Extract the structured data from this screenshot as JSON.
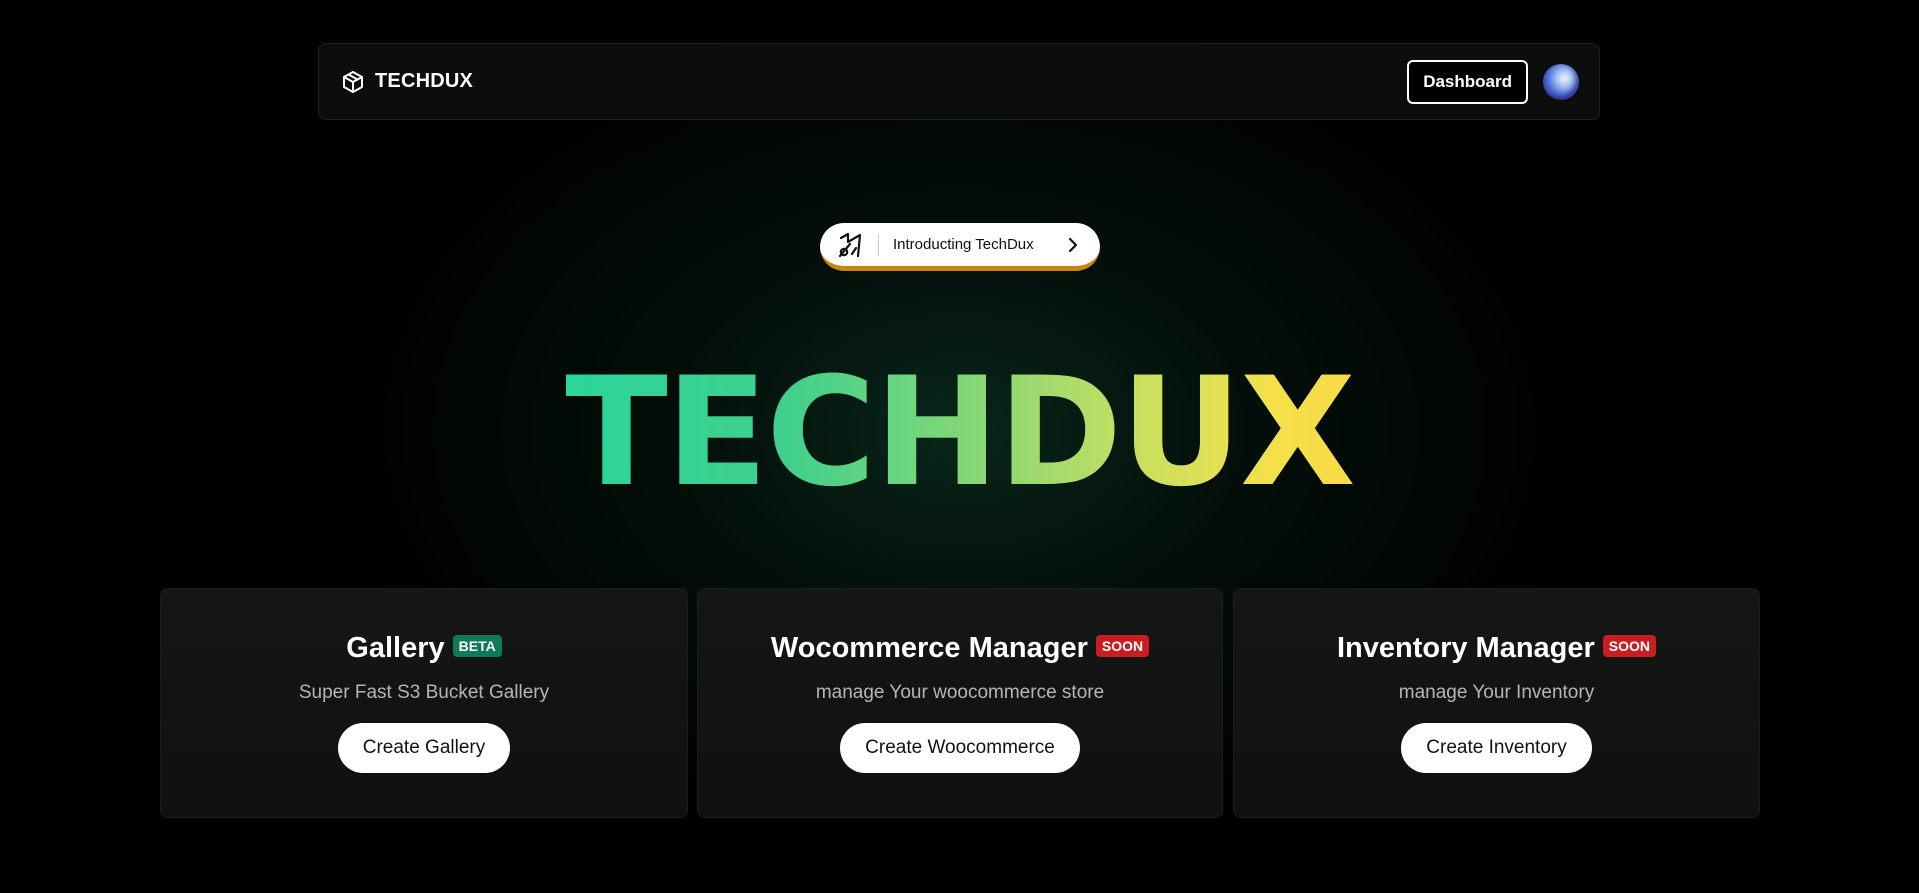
{
  "navbar": {
    "brand_name": "TECHDUX",
    "brand_icon": "cube-icon",
    "dashboard_label": "Dashboard",
    "avatar_icon": "user-avatar"
  },
  "announcement": {
    "text": "Introducting TechDux",
    "logo_icon": "techdux-logo-icon",
    "chevron_icon": "chevron-right-icon",
    "accent_color": "#c8860e"
  },
  "hero": {
    "title": "TECHDUX",
    "gradient_colors": [
      "#2bd59b",
      "#8fd874",
      "#f8da46"
    ]
  },
  "cards": [
    {
      "title": "Gallery",
      "badge": "BETA",
      "badge_color": "#0e7a57",
      "description": "Super Fast S3 Bucket Gallery",
      "button_label": "Create Gallery"
    },
    {
      "title": "Wocommerce Manager",
      "badge": "SOON",
      "badge_color": "#c81e22",
      "description": "manage Your woocommerce store",
      "button_label": "Create Woocommerce"
    },
    {
      "title": "Inventory Manager",
      "badge": "SOON",
      "badge_color": "#c81e22",
      "description": "manage Your Inventory",
      "button_label": "Create Inventory"
    }
  ]
}
